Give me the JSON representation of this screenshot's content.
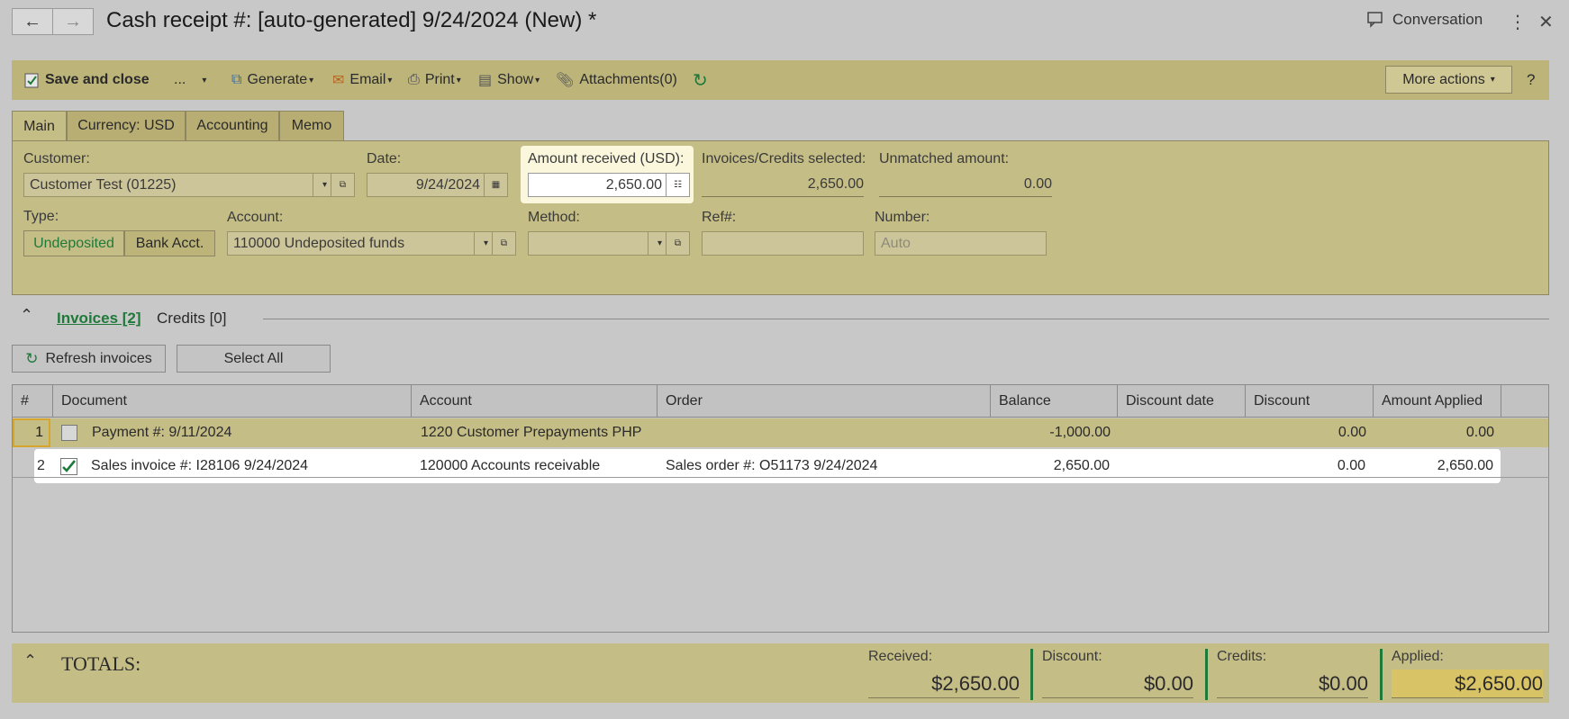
{
  "window": {
    "title": "Cash receipt #: [auto-generated] 9/24/2024 (New) *",
    "conversation_label": "Conversation"
  },
  "toolbar": {
    "save_close": "Save and close",
    "more_dots": "...",
    "generate": "Generate",
    "email": "Email",
    "print": "Print",
    "show": "Show",
    "attachments": "Attachments(0)",
    "more_actions": "More actions",
    "help": "?"
  },
  "tabs": [
    {
      "label": "Main",
      "active": true
    },
    {
      "label": "Currency: USD",
      "active": false
    },
    {
      "label": "Accounting",
      "active": false
    },
    {
      "label": "Memo",
      "active": false
    }
  ],
  "form": {
    "customer_label": "Customer:",
    "customer_value": "Customer Test (01225)",
    "date_label": "Date:",
    "date_value": "9/24/2024",
    "amount_label": "Amount received (USD):",
    "amount_value": "2,650.00",
    "selected_label": "Invoices/Credits selected:",
    "selected_value": "2,650.00",
    "unmatched_label": "Unmatched amount:",
    "unmatched_value": "0.00",
    "type_label": "Type:",
    "type_options": [
      "Undeposited",
      "Bank Acct."
    ],
    "type_selected": "Undeposited",
    "account_label": "Account:",
    "account_value": "110000 Undeposited funds",
    "method_label": "Method:",
    "method_value": "",
    "ref_label": "Ref#:",
    "ref_value": "",
    "number_label": "Number:",
    "number_placeholder": "Auto"
  },
  "section": {
    "invoices_tab": "Invoices [2]",
    "credits_tab": "Credits [0]",
    "refresh_button": "Refresh invoices",
    "select_all_button": "Select All"
  },
  "grid": {
    "columns": [
      "#",
      "Document",
      "Account",
      "Order",
      "Balance",
      "Discount date",
      "Discount",
      "Amount Applied"
    ],
    "rows": [
      {
        "num": "1",
        "checked": false,
        "document": "Payment #:  9/11/2024",
        "account": "1220 Customer Prepayments PHP",
        "order": "",
        "balance": "-1,000.00",
        "discount_date": "",
        "discount": "0.00",
        "applied": "0.00"
      },
      {
        "num": "2",
        "checked": true,
        "document": "Sales invoice #: I28106 9/24/2024",
        "account": "120000 Accounts receivable",
        "order": "Sales order #: O51173 9/24/2024",
        "balance": "2,650.00",
        "discount_date": "",
        "discount": "0.00",
        "applied": "2,650.00"
      }
    ]
  },
  "totals": {
    "title": "TOTALS:",
    "received_label": "Received:",
    "received_value": "$2,650.00",
    "discount_label": "Discount:",
    "discount_value": "$0.00",
    "credits_label": "Credits:",
    "credits_value": "$0.00",
    "applied_label": "Applied:",
    "applied_value": "$2,650.00"
  },
  "colors": {
    "toolbar_bg": "#bdb47a",
    "panel_bg": "#c5bd86",
    "accent_green": "#1f7a3a",
    "highlight": "#fbf7dc",
    "row_border": "#d6a52c"
  },
  "icons": [
    "back-arrow-icon",
    "forward-arrow-icon",
    "conversation-icon",
    "kebab-menu-icon",
    "close-icon",
    "save-icon",
    "generate-icon",
    "email-icon",
    "print-icon",
    "show-icon",
    "paperclip-icon",
    "refresh-icon",
    "calendar-icon",
    "calculator-icon",
    "open-link-icon",
    "chevron-up-icon",
    "checkmark-icon"
  ]
}
